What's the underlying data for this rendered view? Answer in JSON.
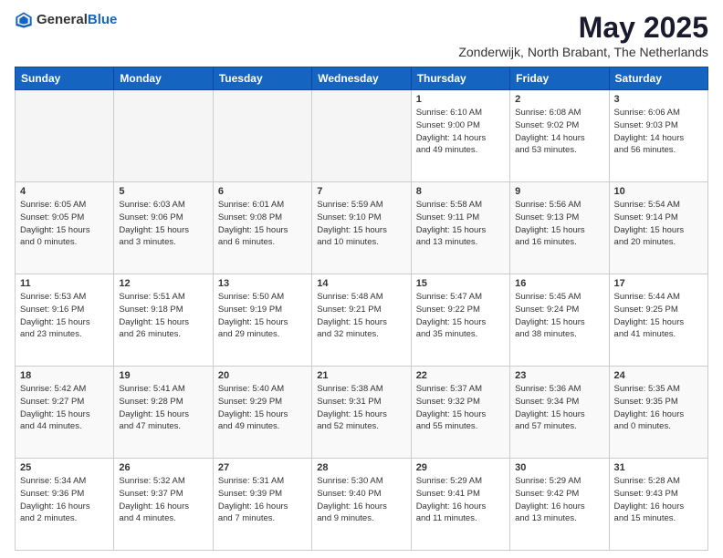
{
  "header": {
    "logo_general": "General",
    "logo_blue": "Blue",
    "month": "May 2025",
    "location": "Zonderwijk, North Brabant, The Netherlands"
  },
  "weekdays": [
    "Sunday",
    "Monday",
    "Tuesday",
    "Wednesday",
    "Thursday",
    "Friday",
    "Saturday"
  ],
  "weeks": [
    [
      {
        "day": "",
        "info": ""
      },
      {
        "day": "",
        "info": ""
      },
      {
        "day": "",
        "info": ""
      },
      {
        "day": "",
        "info": ""
      },
      {
        "day": "1",
        "info": "Sunrise: 6:10 AM\nSunset: 9:00 PM\nDaylight: 14 hours\nand 49 minutes."
      },
      {
        "day": "2",
        "info": "Sunrise: 6:08 AM\nSunset: 9:02 PM\nDaylight: 14 hours\nand 53 minutes."
      },
      {
        "day": "3",
        "info": "Sunrise: 6:06 AM\nSunset: 9:03 PM\nDaylight: 14 hours\nand 56 minutes."
      }
    ],
    [
      {
        "day": "4",
        "info": "Sunrise: 6:05 AM\nSunset: 9:05 PM\nDaylight: 15 hours\nand 0 minutes."
      },
      {
        "day": "5",
        "info": "Sunrise: 6:03 AM\nSunset: 9:06 PM\nDaylight: 15 hours\nand 3 minutes."
      },
      {
        "day": "6",
        "info": "Sunrise: 6:01 AM\nSunset: 9:08 PM\nDaylight: 15 hours\nand 6 minutes."
      },
      {
        "day": "7",
        "info": "Sunrise: 5:59 AM\nSunset: 9:10 PM\nDaylight: 15 hours\nand 10 minutes."
      },
      {
        "day": "8",
        "info": "Sunrise: 5:58 AM\nSunset: 9:11 PM\nDaylight: 15 hours\nand 13 minutes."
      },
      {
        "day": "9",
        "info": "Sunrise: 5:56 AM\nSunset: 9:13 PM\nDaylight: 15 hours\nand 16 minutes."
      },
      {
        "day": "10",
        "info": "Sunrise: 5:54 AM\nSunset: 9:14 PM\nDaylight: 15 hours\nand 20 minutes."
      }
    ],
    [
      {
        "day": "11",
        "info": "Sunrise: 5:53 AM\nSunset: 9:16 PM\nDaylight: 15 hours\nand 23 minutes."
      },
      {
        "day": "12",
        "info": "Sunrise: 5:51 AM\nSunset: 9:18 PM\nDaylight: 15 hours\nand 26 minutes."
      },
      {
        "day": "13",
        "info": "Sunrise: 5:50 AM\nSunset: 9:19 PM\nDaylight: 15 hours\nand 29 minutes."
      },
      {
        "day": "14",
        "info": "Sunrise: 5:48 AM\nSunset: 9:21 PM\nDaylight: 15 hours\nand 32 minutes."
      },
      {
        "day": "15",
        "info": "Sunrise: 5:47 AM\nSunset: 9:22 PM\nDaylight: 15 hours\nand 35 minutes."
      },
      {
        "day": "16",
        "info": "Sunrise: 5:45 AM\nSunset: 9:24 PM\nDaylight: 15 hours\nand 38 minutes."
      },
      {
        "day": "17",
        "info": "Sunrise: 5:44 AM\nSunset: 9:25 PM\nDaylight: 15 hours\nand 41 minutes."
      }
    ],
    [
      {
        "day": "18",
        "info": "Sunrise: 5:42 AM\nSunset: 9:27 PM\nDaylight: 15 hours\nand 44 minutes."
      },
      {
        "day": "19",
        "info": "Sunrise: 5:41 AM\nSunset: 9:28 PM\nDaylight: 15 hours\nand 47 minutes."
      },
      {
        "day": "20",
        "info": "Sunrise: 5:40 AM\nSunset: 9:29 PM\nDaylight: 15 hours\nand 49 minutes."
      },
      {
        "day": "21",
        "info": "Sunrise: 5:38 AM\nSunset: 9:31 PM\nDaylight: 15 hours\nand 52 minutes."
      },
      {
        "day": "22",
        "info": "Sunrise: 5:37 AM\nSunset: 9:32 PM\nDaylight: 15 hours\nand 55 minutes."
      },
      {
        "day": "23",
        "info": "Sunrise: 5:36 AM\nSunset: 9:34 PM\nDaylight: 15 hours\nand 57 minutes."
      },
      {
        "day": "24",
        "info": "Sunrise: 5:35 AM\nSunset: 9:35 PM\nDaylight: 16 hours\nand 0 minutes."
      }
    ],
    [
      {
        "day": "25",
        "info": "Sunrise: 5:34 AM\nSunset: 9:36 PM\nDaylight: 16 hours\nand 2 minutes."
      },
      {
        "day": "26",
        "info": "Sunrise: 5:32 AM\nSunset: 9:37 PM\nDaylight: 16 hours\nand 4 minutes."
      },
      {
        "day": "27",
        "info": "Sunrise: 5:31 AM\nSunset: 9:39 PM\nDaylight: 16 hours\nand 7 minutes."
      },
      {
        "day": "28",
        "info": "Sunrise: 5:30 AM\nSunset: 9:40 PM\nDaylight: 16 hours\nand 9 minutes."
      },
      {
        "day": "29",
        "info": "Sunrise: 5:29 AM\nSunset: 9:41 PM\nDaylight: 16 hours\nand 11 minutes."
      },
      {
        "day": "30",
        "info": "Sunrise: 5:29 AM\nSunset: 9:42 PM\nDaylight: 16 hours\nand 13 minutes."
      },
      {
        "day": "31",
        "info": "Sunrise: 5:28 AM\nSunset: 9:43 PM\nDaylight: 16 hours\nand 15 minutes."
      }
    ]
  ]
}
